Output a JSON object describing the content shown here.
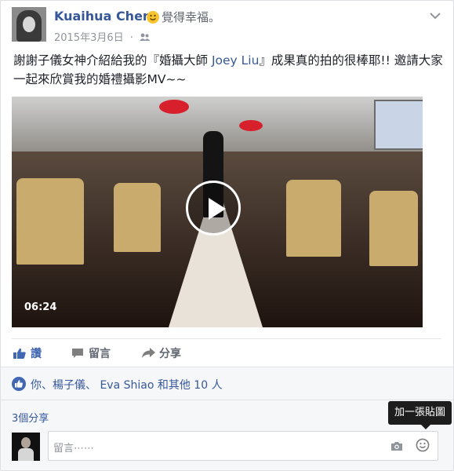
{
  "post": {
    "author": "Kuaihua Chen",
    "feeling": "覺得幸福。",
    "date": "2015年3月6日",
    "separator": "·",
    "message_part1": "謝謝子儀女神介紹給我的『婚攝大師 ",
    "message_link": "Joey Liu",
    "message_part2": "』成果真的拍的很棒耶!! 邀請大家一起來欣賞我的婚禮攝影MV~~"
  },
  "video": {
    "duration": "06:24"
  },
  "actions": {
    "like": "讚",
    "comment": "留言",
    "share": "分享"
  },
  "likes": {
    "text": "你、楊子儀、 Eva Shiao 和其他 10 人"
  },
  "shares": {
    "text": "3個分享"
  },
  "tooltip": {
    "text": "加一張貼圖"
  },
  "comment_box": {
    "placeholder": "留言⋯⋯"
  },
  "colors": {
    "link": "#365899",
    "like_blue": "#4267b2",
    "muted": "#90949c"
  }
}
